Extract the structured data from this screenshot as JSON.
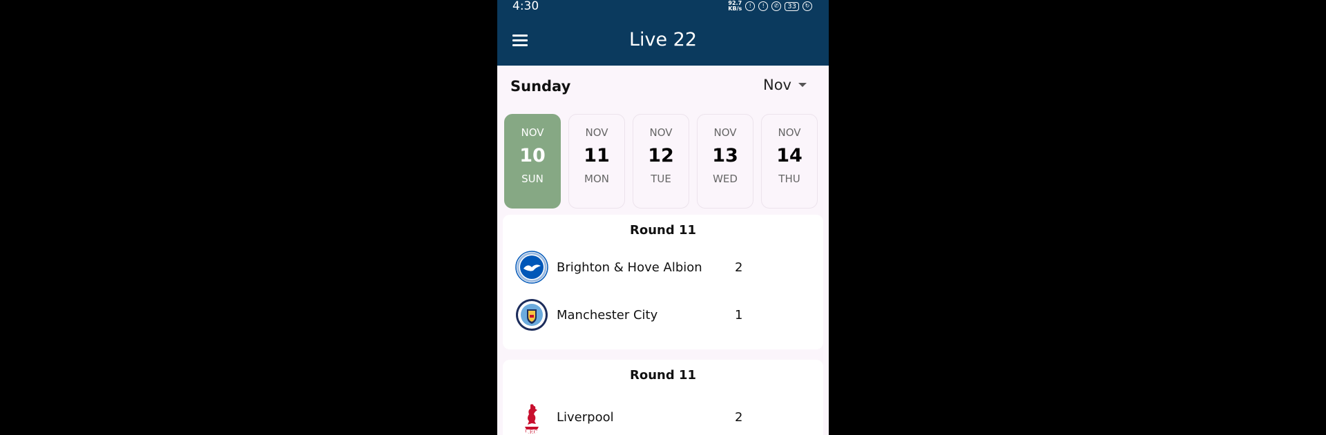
{
  "status": {
    "time": "4:30",
    "speed_top": "92.7",
    "speed_unit": "KB/s",
    "battery": "33"
  },
  "header": {
    "title": "Live 22"
  },
  "day_bar": {
    "day_name": "Sunday",
    "month": "Nov"
  },
  "dates": [
    {
      "month": "NOV",
      "day": "10",
      "weekday": "SUN",
      "selected": true
    },
    {
      "month": "NOV",
      "day": "11",
      "weekday": "MON",
      "selected": false
    },
    {
      "month": "NOV",
      "day": "12",
      "weekday": "TUE",
      "selected": false
    },
    {
      "month": "NOV",
      "day": "13",
      "weekday": "WED",
      "selected": false
    },
    {
      "month": "NOV",
      "day": "14",
      "weekday": "THU",
      "selected": false
    }
  ],
  "matches": [
    {
      "round": "Round 11",
      "home": {
        "name": "Brighton & Hove Albion",
        "score": "2",
        "crest": "brighton-crest-icon"
      },
      "away": {
        "name": "Manchester City",
        "score": "1",
        "crest": "man-city-crest-icon"
      }
    },
    {
      "round": "Round 11",
      "home": {
        "name": "Liverpool",
        "score": "2",
        "crest": "liverpool-crest-icon"
      }
    }
  ],
  "colors": {
    "header_bg": "#0b3a5e",
    "selected_date_bg": "#86a884",
    "page_bg": "#fbf5fb"
  }
}
